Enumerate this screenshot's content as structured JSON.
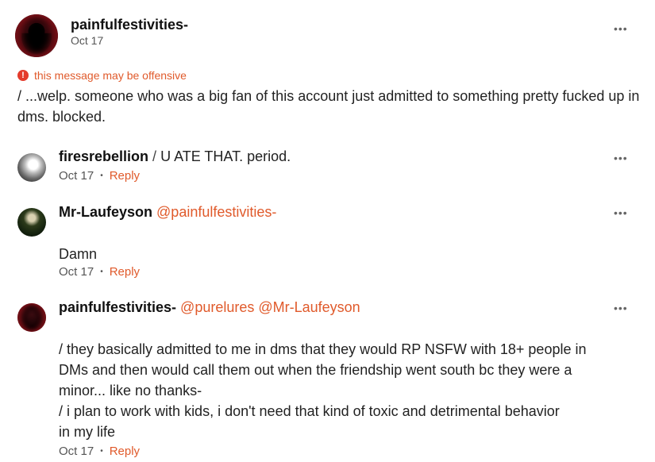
{
  "post": {
    "username": "painfulfestivities-",
    "date": "Oct 17",
    "warning": "this message may be offensive",
    "body": "/ ...welp. someone who was a big fan of this account just admitted to something pretty fucked up in dms. blocked.",
    "more_icon": "•••"
  },
  "comments": [
    {
      "username": "firesrebellion",
      "separator": " / ",
      "text": "U ATE THAT. period.",
      "date": "Oct 17",
      "reply": "Reply",
      "more_icon": "•••"
    },
    {
      "username": "Mr-Laufeyson",
      "mention": "@painfulfestivities-",
      "text": "Damn",
      "date": "Oct 17",
      "reply": "Reply",
      "more_icon": "•••"
    },
    {
      "username": "painfulfestivities-",
      "mentions": "@purelures @Mr-Laufeyson",
      "text_lines": [
        "/ they basically admitted to me in dms that they would RP NSFW with 18+ people in",
        "DMs and then would call them out when the friendship went south bc they were a",
        "minor... like no thanks-",
        "/ i plan to work with kids, i don't need that kind of toxic and detrimental behavior",
        "in my life"
      ],
      "date": "Oct 17",
      "reply": "Reply",
      "more_icon": "•••"
    }
  ],
  "colors": {
    "accent": "#e05a2b",
    "warning_icon": "#e43b2c"
  },
  "icons": {
    "warning": "warning-icon",
    "more": "more-options-icon",
    "dot": "•"
  }
}
